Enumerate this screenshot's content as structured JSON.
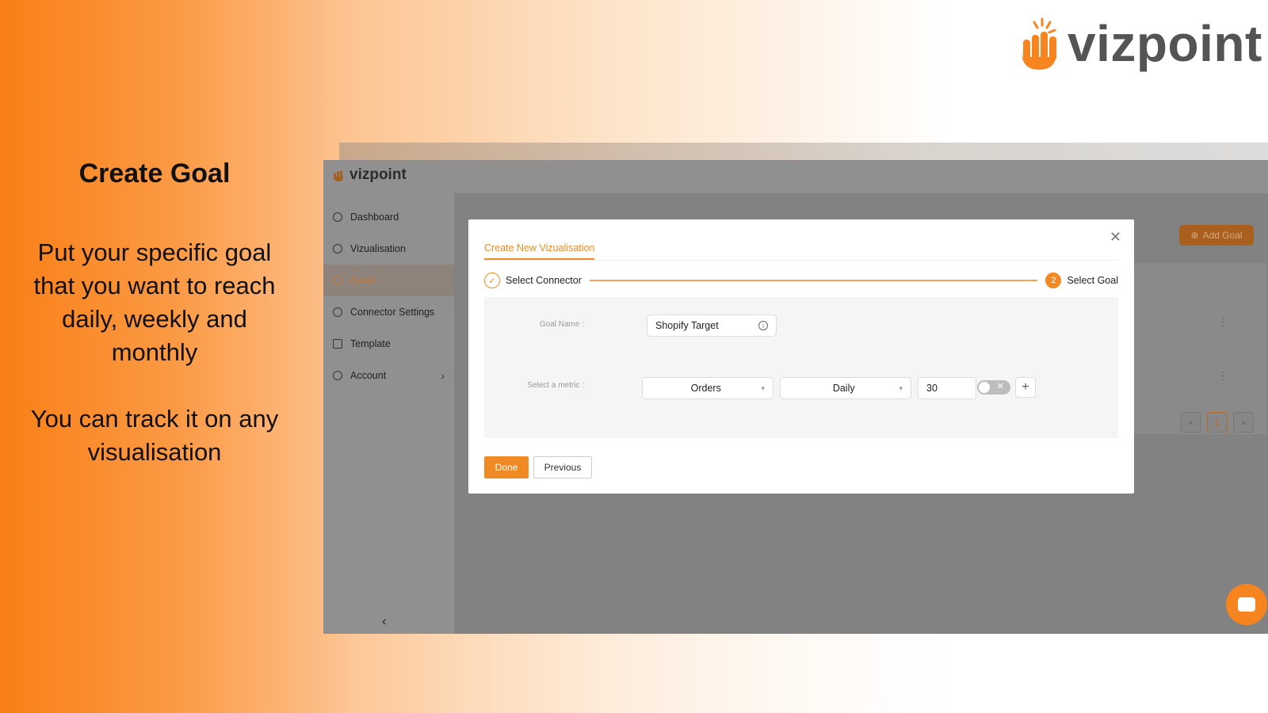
{
  "brand": {
    "name": "vizpoint",
    "accent": "#f7851f",
    "text_color": "#545454"
  },
  "copy": {
    "title": "Create Goal",
    "para1": "Put your specific goal that you want to reach daily, weekly and monthly",
    "para2": "You can track it on any visualisation"
  },
  "app": {
    "logo": "vizpoint",
    "nav": [
      {
        "label": "Dashboard",
        "icon": "dashboard-icon"
      },
      {
        "label": "Vizualisation",
        "icon": "chart-icon"
      },
      {
        "label": "Goals",
        "icon": "target-icon",
        "active": true
      },
      {
        "label": "Connector Settings",
        "icon": "gear-icon"
      },
      {
        "label": "Template",
        "icon": "template-icon"
      },
      {
        "label": "Account",
        "icon": "user-icon",
        "has_submenu": true
      }
    ],
    "collapse_icon": "chevron-left-icon",
    "add_goal_label": "Add Goal",
    "pagination": {
      "current": "1"
    }
  },
  "modal": {
    "tab_label": "Create New Vizualisation",
    "close_icon": "close-icon",
    "steps": [
      {
        "label": "Select Connector",
        "status": "done"
      },
      {
        "number": "2",
        "label": "Select Goal",
        "status": "current"
      }
    ],
    "goal_name_label": "Goal Name :",
    "goal_name_value": "Shopify Target",
    "metric_label": "Select a metric :",
    "metric_value": "Orders",
    "period_value": "Daily",
    "target_value": "30",
    "toggle_on": false,
    "done_label": "Done",
    "previous_label": "Previous"
  }
}
